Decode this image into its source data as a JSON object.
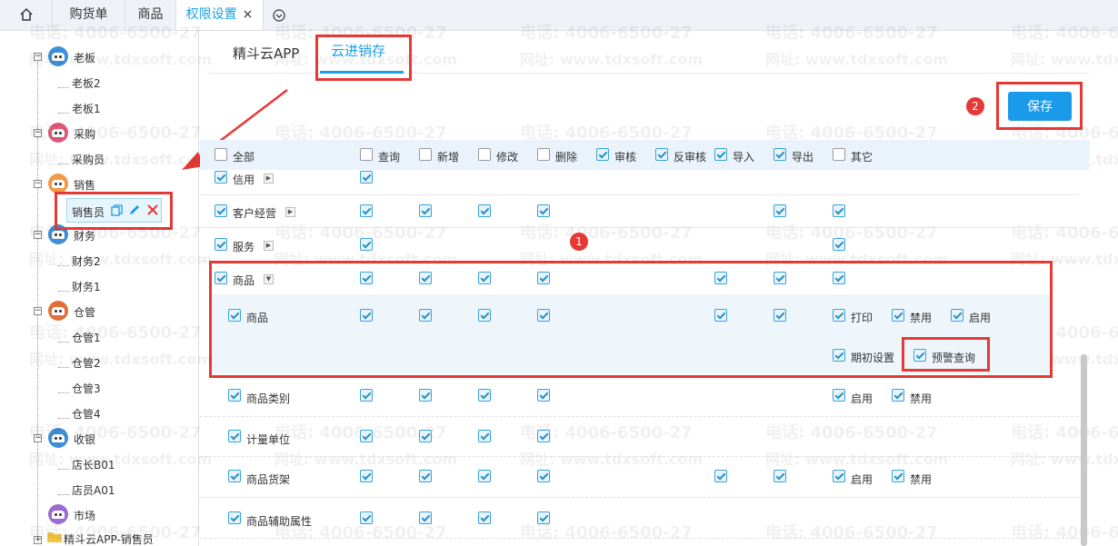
{
  "tabs": [
    {
      "label": "购货单"
    },
    {
      "label": "商品"
    },
    {
      "label": "权限设置",
      "active": true
    }
  ],
  "tab_close_glyph": "×",
  "sidebar": {
    "groups": [
      {
        "label": "老板",
        "color": "#3d8fd8",
        "children": [
          "老板2",
          "老板1"
        ]
      },
      {
        "label": "采购",
        "color": "#e05a7a",
        "children": [
          "采购员"
        ]
      },
      {
        "label": "销售",
        "color": "#f2994a",
        "children": [
          "销售员"
        ]
      },
      {
        "label": "财务",
        "color": "#3d8fd8",
        "children": [
          "财务2",
          "财务1"
        ]
      },
      {
        "label": "仓管",
        "color": "#e0703a",
        "children": [
          "仓管1",
          "仓管2",
          "仓管3",
          "仓管4"
        ]
      },
      {
        "label": "收银",
        "color": "#3d8fd8",
        "children": [
          "店长B01",
          "店员A01"
        ]
      },
      {
        "label": "市场",
        "color": "#9b6bd1",
        "children": []
      }
    ],
    "folder_label": "精斗云APP-销售员"
  },
  "subtabs": [
    {
      "label": "精斗云APP"
    },
    {
      "label": "云进销存",
      "active": true
    }
  ],
  "save_label": "保存",
  "badges": [
    "1",
    "2"
  ],
  "watermark": {
    "phone": "电话: 4006-6500-27",
    "url": "网址: www.tdxsoft.com"
  },
  "columns": [
    "全部",
    "查询",
    "新增",
    "修改",
    "删除",
    "审核",
    "反审核",
    "导入",
    "导出",
    "其它"
  ],
  "rows": [
    {
      "label": "信用",
      "checked": true,
      "has_expander": true
    },
    {
      "label": "客户经营",
      "checked": true,
      "has_expander": true
    },
    {
      "label": "服务",
      "checked": true,
      "has_expander": true
    },
    {
      "label": "商品",
      "checked": true,
      "has_expander": true,
      "expanded": true
    },
    {
      "label": "商品",
      "checked": true,
      "extras": [
        "打印",
        "禁用",
        "启用",
        "期初设置",
        "预警查询"
      ]
    },
    {
      "label": "商品类别",
      "checked": true,
      "extras": [
        "启用",
        "禁用"
      ]
    },
    {
      "label": "计量单位",
      "checked": true
    },
    {
      "label": "商品货架",
      "checked": true,
      "extras": [
        "启用",
        "禁用"
      ]
    },
    {
      "label": "商品辅助属性",
      "checked": true
    }
  ],
  "colors": {
    "accent": "#1a9be9",
    "annotation": "#e53935",
    "checkbox": "#3aa4d8"
  }
}
